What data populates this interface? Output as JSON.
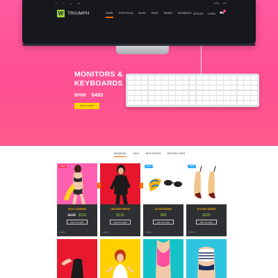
{
  "topbar": {
    "social": [
      "f",
      "t",
      "p",
      "in"
    ],
    "languages": [
      "USD",
      "EN"
    ]
  },
  "header": {
    "logo_mark": "W",
    "logo_text": "TRIUMPH",
    "nav": [
      "Home",
      "Portfolio",
      "Blog",
      "Shop",
      "Pages",
      "Elements"
    ],
    "active_nav": "Home",
    "sign_up": "Sign up",
    "login": "Login",
    "cart_count": "0"
  },
  "hero": {
    "title_line1": "MONITORS &",
    "title_line2": "KEYBOARDS",
    "price_old": "$708",
    "price_new": "$455",
    "button": "Add to cart"
  },
  "filters": {
    "tabs": [
      "Show all",
      "Sale",
      "New shoes",
      "Bestsellers"
    ],
    "active": "Show all"
  },
  "products": [
    {
      "badge": "Sale",
      "badge_color": "#ff3b5c",
      "name": "Sexy Lingerie",
      "price_old": "$178",
      "price": "$152",
      "add_label": "Add to cart",
      "category": "Lingerie"
    },
    {
      "badge": "",
      "badge_color": "",
      "name": "Leather Dress",
      "price_old": "",
      "price": "$133",
      "add_label": "Add to cart",
      "category": "Clothing"
    },
    {
      "badge": "New",
      "badge_color": "#2aa7ff",
      "name": "Accessories",
      "price_old": "",
      "price": "$58",
      "add_label": "Add to cart",
      "category": "Clothing"
    },
    {
      "badge": "New",
      "badge_color": "#2aa7ff",
      "name": "Stylish Shoes",
      "price_old": "",
      "price": "$325",
      "add_label": "Add to cart",
      "category": "Clothing"
    }
  ],
  "colors": {
    "hero_pink": "#ff4f93",
    "accent_orange": "#ff6a00",
    "accent_yellow": "#ffd400",
    "price_green": "#9bd43a"
  }
}
